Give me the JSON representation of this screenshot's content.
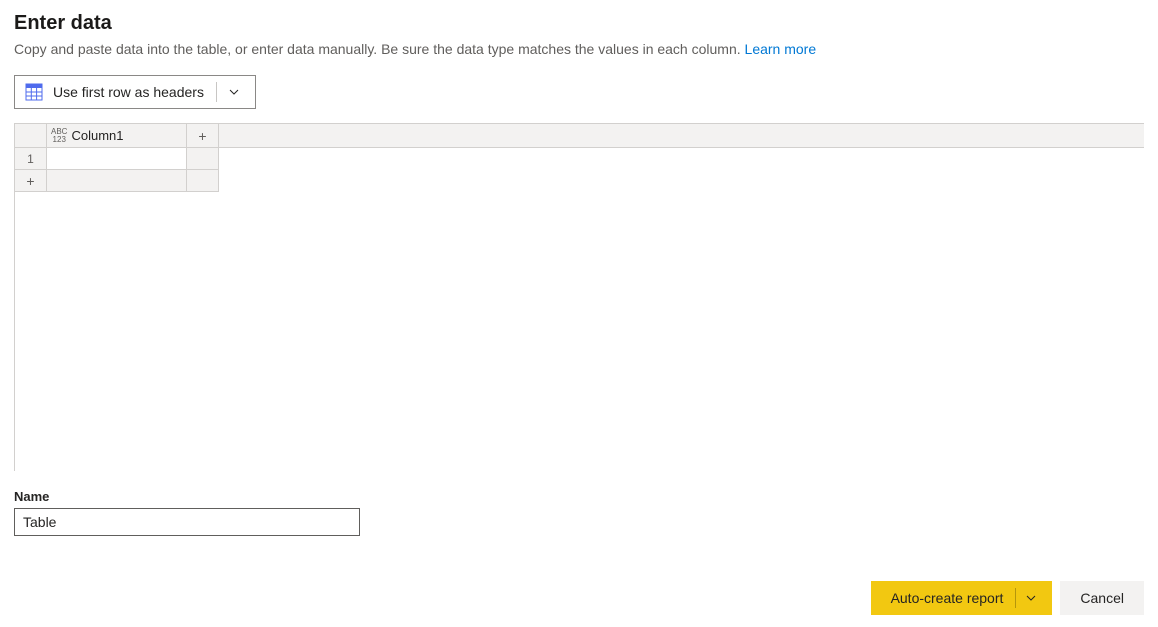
{
  "header": {
    "title": "Enter data",
    "subtitle": "Copy and paste data into the table, or enter data manually. Be sure the data type matches the values in each column. ",
    "learn_more": "Learn more"
  },
  "toolbar": {
    "use_first_row_label": "Use first row as headers"
  },
  "grid": {
    "columns": [
      {
        "name": "Column1",
        "datatype_label_top": "ABC",
        "datatype_label_bottom": "123"
      }
    ],
    "rows": [
      {
        "num": "1",
        "cells": [
          ""
        ]
      }
    ],
    "add_col_symbol": "+",
    "add_row_symbol": "+"
  },
  "name_field": {
    "label": "Name",
    "value": "Table"
  },
  "footer": {
    "primary_label": "Auto-create report",
    "cancel_label": "Cancel"
  }
}
